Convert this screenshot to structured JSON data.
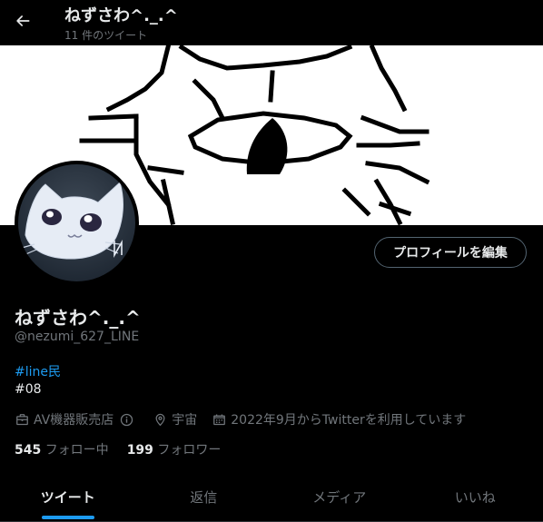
{
  "header": {
    "title": "ねずさわ^._.^",
    "tweet_count": "11 件のツイート"
  },
  "profile": {
    "display_name": "ねずさわ^._.^",
    "handle": "@nezumi_627_LINE",
    "bio_hashtag": "#line民",
    "bio_line2": "#08",
    "edit_button_label": "プロフィールを編集",
    "category": "AV機器販売店",
    "location": "宇宙",
    "joined": "2022年9月からTwitterを利用しています",
    "following_count": "545",
    "following_label": "フォロー中",
    "followers_count": "199",
    "followers_label": "フォロワー"
  },
  "tabs": [
    {
      "label": "ツイート",
      "active": true
    },
    {
      "label": "返信",
      "active": false
    },
    {
      "label": "メディア",
      "active": false
    },
    {
      "label": "いいね",
      "active": false
    }
  ],
  "colors": {
    "background": "#000000",
    "accent": "#1d9bf0",
    "secondary_text": "#71767b",
    "primary_text": "#e7e9ea",
    "button_border": "#536471"
  },
  "icons": [
    "back-arrow-icon",
    "briefcase-icon",
    "info-icon",
    "location-pin-icon",
    "calendar-icon"
  ]
}
